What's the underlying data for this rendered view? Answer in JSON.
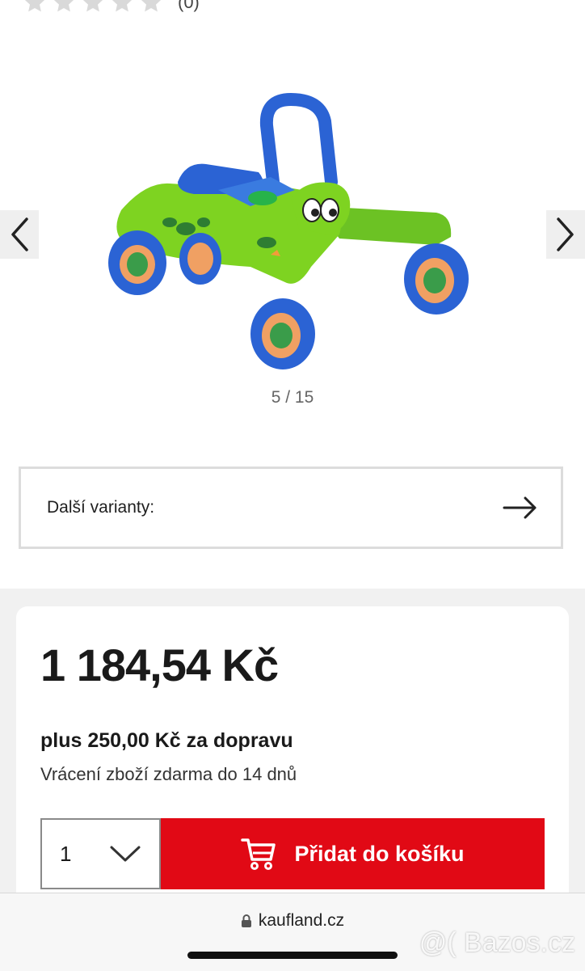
{
  "rating": {
    "count_text": "(0)",
    "stars_filled": 0,
    "stars_total": 5
  },
  "gallery": {
    "counter": "5 / 15"
  },
  "variants": {
    "label": "Další varianty:"
  },
  "offer": {
    "price": "1 184,54 Kč",
    "shipping": "plus 250,00 Kč za dopravu",
    "returns": "Vrácení zboží zdarma do 14 dnů",
    "quantity": "1",
    "add_to_cart": "Přidat do košíku"
  },
  "browser": {
    "url": "kaufland.cz"
  },
  "watermark": {
    "text": "@( Bazos.cz"
  },
  "colors": {
    "accent": "#e10915",
    "toy_green": "#7ed321",
    "toy_blue": "#2b63d4"
  },
  "icons": [
    "star-icon",
    "chevron-left-icon",
    "chevron-right-icon",
    "arrow-right-icon",
    "chevron-down-icon",
    "cart-icon",
    "lock-icon"
  ]
}
